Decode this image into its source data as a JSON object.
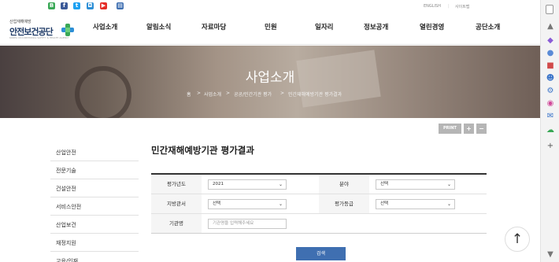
{
  "social": {
    "labels": [
      "B",
      "f",
      "t",
      "◘",
      "▶",
      "▤"
    ],
    "colors": [
      "#3aa856",
      "#3b5998",
      "#1da1f2",
      "#2d8fd6",
      "#e52d27",
      "#3f6fb1"
    ]
  },
  "util_links": [
    "ENGLISH",
    "사이트맵"
  ],
  "logo": {
    "small_text": "산업재해예방",
    "name": "안전보건공단",
    "en": "KOREA OCCUPATIONAL SAFETY & HEALTH AGENCY"
  },
  "menu": [
    "사업소개",
    "알림소식",
    "자료마당",
    "민원",
    "일자리",
    "정보공개",
    "열린경영",
    "공단소개"
  ],
  "visual": {
    "title": "사업소개",
    "breadcrumb": [
      "홈",
      ">",
      "사업소개",
      ">",
      "공공/민간기관 평가",
      ">",
      "민간재해예방기관 평가결과"
    ]
  },
  "tools": {
    "print": "PRINT",
    "plus": "+",
    "minus": "−"
  },
  "lnb": [
    "산업안전",
    "전문기술",
    "건설안전",
    "서비스안전",
    "산업보건",
    "재정지원",
    "교육/인재"
  ],
  "content": {
    "title": "민간재해예방기관 평가결과",
    "labels": {
      "year": "평가년도",
      "field": "분야",
      "region": "지방관서",
      "grade": "평가등급",
      "org": "기관명"
    },
    "values": {
      "year": "2021",
      "field": "선택",
      "region": "선택",
      "grade": "선택"
    },
    "org_placeholder": "기관명을 입력해주세요",
    "search_button": "검색",
    "top_button": "↑"
  },
  "scrollbar_icons": [
    "▲",
    "◆",
    "●",
    "■",
    "☻",
    "⚙",
    "◉",
    "✉",
    "☁",
    "+",
    "▼"
  ]
}
